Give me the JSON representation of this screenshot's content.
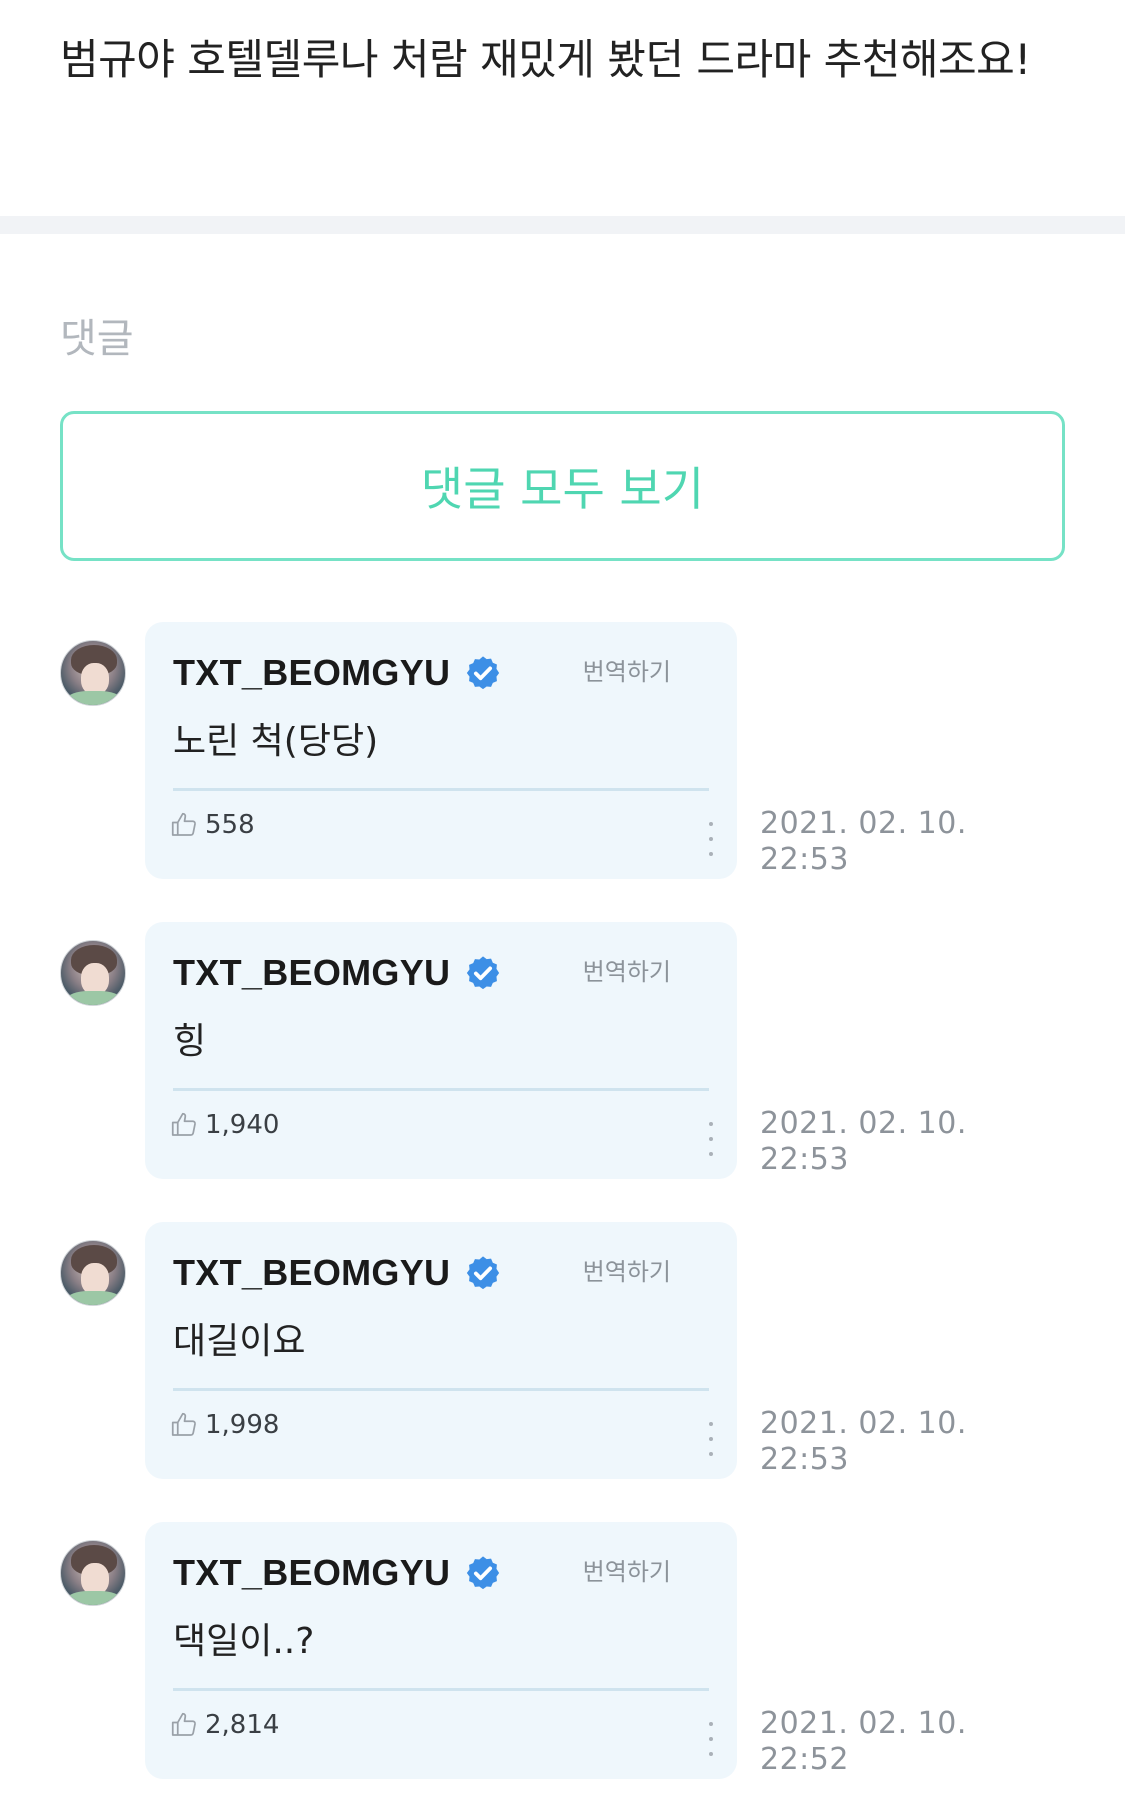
{
  "post": {
    "text": "범규야 호텔델루나 처람 재밌게 봤던 드라마 추천해조요!"
  },
  "comments_section": {
    "heading": "댓글",
    "view_all_label": "댓글 모두 보기"
  },
  "colors": {
    "accent": "#4fd6b1",
    "bubble_bg": "#eff7fc",
    "verified_blue": "#3d8fe6"
  },
  "comments": [
    {
      "author": "TXT_BEOMGYU",
      "verified_icon": "verified-badge-icon",
      "translate_label": "번역하기",
      "text": "노린 척(당당)",
      "likes": "558",
      "date": "2021. 02. 10.",
      "time": "22:53"
    },
    {
      "author": "TXT_BEOMGYU",
      "verified_icon": "verified-badge-icon",
      "translate_label": "번역하기",
      "text": "힝",
      "likes": "1,940",
      "date": "2021. 02. 10.",
      "time": "22:53"
    },
    {
      "author": "TXT_BEOMGYU",
      "verified_icon": "verified-badge-icon",
      "translate_label": "번역하기",
      "text": "대길이요",
      "likes": "1,998",
      "date": "2021. 02. 10.",
      "time": "22:53"
    },
    {
      "author": "TXT_BEOMGYU",
      "verified_icon": "verified-badge-icon",
      "translate_label": "번역하기",
      "text": "댁일이..?",
      "likes": "2,814",
      "date": "2021. 02. 10.",
      "time": "22:52"
    }
  ]
}
